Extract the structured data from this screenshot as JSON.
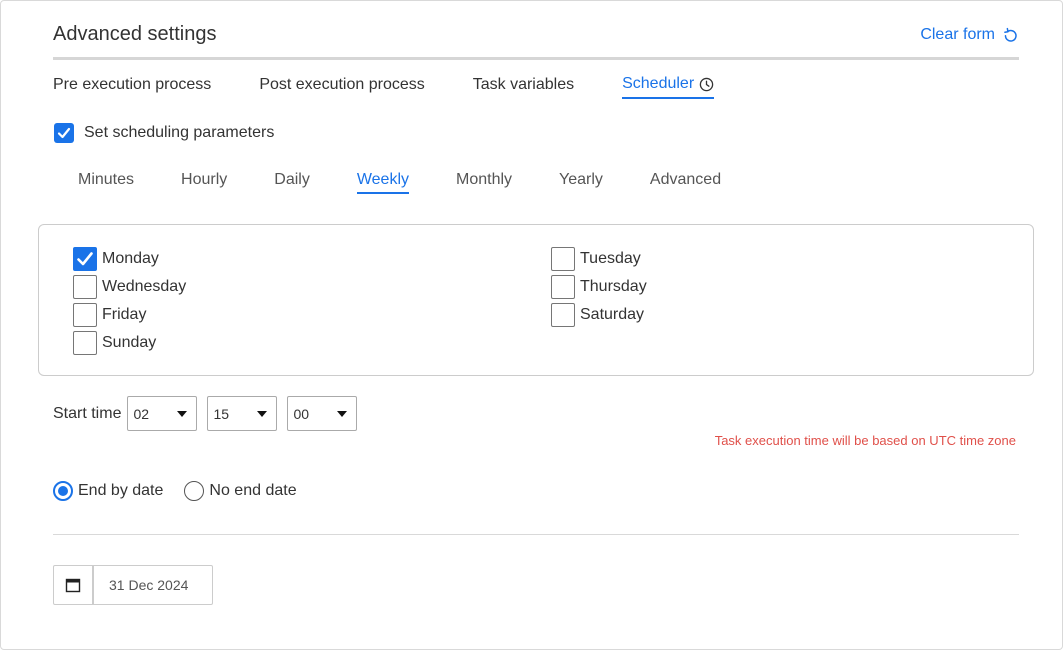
{
  "header": {
    "title": "Advanced settings",
    "clear_form_label": "Clear form"
  },
  "main_tabs": [
    {
      "label": "Pre execution process",
      "active": false
    },
    {
      "label": "Post execution process",
      "active": false
    },
    {
      "label": "Task variables",
      "active": false
    },
    {
      "label": "Scheduler",
      "active": true
    }
  ],
  "set_params": {
    "label": "Set scheduling parameters",
    "checked": true
  },
  "freq_tabs": [
    {
      "label": "Minutes",
      "active": false
    },
    {
      "label": "Hourly",
      "active": false
    },
    {
      "label": "Daily",
      "active": false
    },
    {
      "label": "Weekly",
      "active": true
    },
    {
      "label": "Monthly",
      "active": false
    },
    {
      "label": "Yearly",
      "active": false
    },
    {
      "label": "Advanced",
      "active": false
    }
  ],
  "days": [
    {
      "label": "Monday",
      "checked": true
    },
    {
      "label": "Tuesday",
      "checked": false
    },
    {
      "label": "Wednesday",
      "checked": false
    },
    {
      "label": "Thursday",
      "checked": false
    },
    {
      "label": "Friday",
      "checked": false
    },
    {
      "label": "Saturday",
      "checked": false
    },
    {
      "label": "Sunday",
      "checked": false
    }
  ],
  "start_time": {
    "label": "Start time",
    "hour": "02",
    "minute": "15",
    "second": "00"
  },
  "utc_note": "Task execution time will be based on UTC time zone",
  "end_options": [
    {
      "label": "End by date",
      "selected": true
    },
    {
      "label": "No end date",
      "selected": false
    }
  ],
  "end_date": {
    "value": "31 Dec 2024"
  },
  "colors": {
    "accent": "#1a73e8",
    "warning": "#e0504a"
  },
  "icons": {
    "clear_form": "refresh-icon",
    "scheduler": "clock-icon",
    "calendar": "calendar-icon",
    "check": "checkmark-icon"
  }
}
